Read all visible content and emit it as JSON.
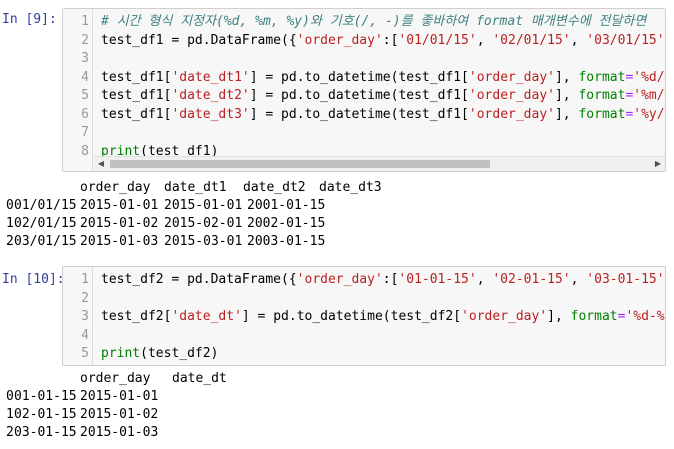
{
  "cell1": {
    "prompt": "In [9]:",
    "lines": [
      {
        "n": "1",
        "tokens": [
          {
            "t": "# 시간 형식 지정자(%d, %m, %y)와 기호(/, -)를 좋바하여 format 매개변수에 전달하면",
            "c": "tok-comment"
          }
        ]
      },
      {
        "n": "2",
        "tokens": [
          {
            "t": "test_df1 = pd.DataFrame({",
            "c": "tok-plain"
          },
          {
            "t": "'order_day'",
            "c": "tok-string"
          },
          {
            "t": ":[",
            "c": "tok-plain"
          },
          {
            "t": "'01/01/15'",
            "c": "tok-string"
          },
          {
            "t": ", ",
            "c": "tok-plain"
          },
          {
            "t": "'02/01/15'",
            "c": "tok-string"
          },
          {
            "t": ", ",
            "c": "tok-plain"
          },
          {
            "t": "'03/01/15'",
            "c": "tok-string"
          },
          {
            "t": "]})",
            "c": "tok-plain"
          }
        ]
      },
      {
        "n": "3",
        "tokens": []
      },
      {
        "n": "4",
        "tokens": [
          {
            "t": "test_df1[",
            "c": "tok-plain"
          },
          {
            "t": "'date_dt1'",
            "c": "tok-string"
          },
          {
            "t": "] = pd.to_datetime(test_df1[",
            "c": "tok-plain"
          },
          {
            "t": "'order_day'",
            "c": "tok-string"
          },
          {
            "t": "], ",
            "c": "tok-plain"
          },
          {
            "t": "format",
            "c": "tok-builtin"
          },
          {
            "t": "=",
            "c": "tok-op"
          },
          {
            "t": "'%d/%m/%y'",
            "c": "tok-string"
          },
          {
            "t": ")",
            "c": "tok-plain"
          }
        ]
      },
      {
        "n": "5",
        "tokens": [
          {
            "t": "test_df1[",
            "c": "tok-plain"
          },
          {
            "t": "'date_dt2'",
            "c": "tok-string"
          },
          {
            "t": "] = pd.to_datetime(test_df1[",
            "c": "tok-plain"
          },
          {
            "t": "'order_day'",
            "c": "tok-string"
          },
          {
            "t": "], ",
            "c": "tok-plain"
          },
          {
            "t": "format",
            "c": "tok-builtin"
          },
          {
            "t": "=",
            "c": "tok-op"
          },
          {
            "t": "'%m/%d/%y'",
            "c": "tok-string"
          },
          {
            "t": ")",
            "c": "tok-plain"
          }
        ]
      },
      {
        "n": "6",
        "tokens": [
          {
            "t": "test_df1[",
            "c": "tok-plain"
          },
          {
            "t": "'date_dt3'",
            "c": "tok-string"
          },
          {
            "t": "] = pd.to_datetime(test_df1[",
            "c": "tok-plain"
          },
          {
            "t": "'order_day'",
            "c": "tok-string"
          },
          {
            "t": "], ",
            "c": "tok-plain"
          },
          {
            "t": "format",
            "c": "tok-builtin"
          },
          {
            "t": "=",
            "c": "tok-op"
          },
          {
            "t": "'%y/%m/%d'",
            "c": "tok-string"
          },
          {
            "t": ")",
            "c": "tok-plain"
          }
        ]
      },
      {
        "n": "7",
        "tokens": []
      },
      {
        "n": "8",
        "tokens": [
          {
            "t": "print",
            "c": "tok-keyword"
          },
          {
            "t": "(test_df1)",
            "c": "tok-plain"
          }
        ]
      }
    ],
    "output": {
      "header": [
        "order_day",
        "date_dt1",
        "date_dt2",
        "date_dt3"
      ],
      "rows": [
        {
          "index": "0",
          "cells": [
            "01/01/15",
            "2015-01-01",
            "2015-01-01",
            "2001-01-15"
          ]
        },
        {
          "index": "1",
          "cells": [
            "02/01/15",
            "2015-01-02",
            "2015-02-01",
            "2002-01-15"
          ]
        },
        {
          "index": "2",
          "cells": [
            "03/01/15",
            "2015-01-03",
            "2015-03-01",
            "2003-01-15"
          ]
        }
      ]
    }
  },
  "cell2": {
    "prompt": "In [10]:",
    "lines": [
      {
        "n": "1",
        "tokens": [
          {
            "t": "test_df2 = pd.DataFrame({",
            "c": "tok-plain"
          },
          {
            "t": "'order_day'",
            "c": "tok-string"
          },
          {
            "t": ":[",
            "c": "tok-plain"
          },
          {
            "t": "'01-01-15'",
            "c": "tok-string"
          },
          {
            "t": ", ",
            "c": "tok-plain"
          },
          {
            "t": "'02-01-15'",
            "c": "tok-string"
          },
          {
            "t": ", ",
            "c": "tok-plain"
          },
          {
            "t": "'03-01-15'",
            "c": "tok-string"
          },
          {
            "t": "]})",
            "c": "tok-plain"
          }
        ]
      },
      {
        "n": "2",
        "tokens": []
      },
      {
        "n": "3",
        "tokens": [
          {
            "t": "test_df2[",
            "c": "tok-plain"
          },
          {
            "t": "'date_dt'",
            "c": "tok-string"
          },
          {
            "t": "] = pd.to_datetime(test_df2[",
            "c": "tok-plain"
          },
          {
            "t": "'order_day'",
            "c": "tok-string"
          },
          {
            "t": "], ",
            "c": "tok-plain"
          },
          {
            "t": "format",
            "c": "tok-builtin"
          },
          {
            "t": "=",
            "c": "tok-op"
          },
          {
            "t": "'%d-%m-%y'",
            "c": "tok-string"
          },
          {
            "t": ")",
            "c": "tok-plain"
          }
        ]
      },
      {
        "n": "4",
        "tokens": []
      },
      {
        "n": "5",
        "tokens": [
          {
            "t": "print",
            "c": "tok-keyword"
          },
          {
            "t": "(test_df2)",
            "c": "tok-plain"
          }
        ]
      }
    ],
    "output": {
      "header": [
        "order_day",
        "date_dt"
      ],
      "rows": [
        {
          "index": "0",
          "cells": [
            "01-01-15",
            "2015-01-01"
          ]
        },
        {
          "index": "1",
          "cells": [
            "02-01-15",
            "2015-01-02"
          ]
        },
        {
          "index": "2",
          "cells": [
            "03-01-15",
            "2015-01-03"
          ]
        }
      ]
    }
  },
  "scrollbar": {
    "left_arrow": "◀",
    "right_arrow": "▶"
  }
}
